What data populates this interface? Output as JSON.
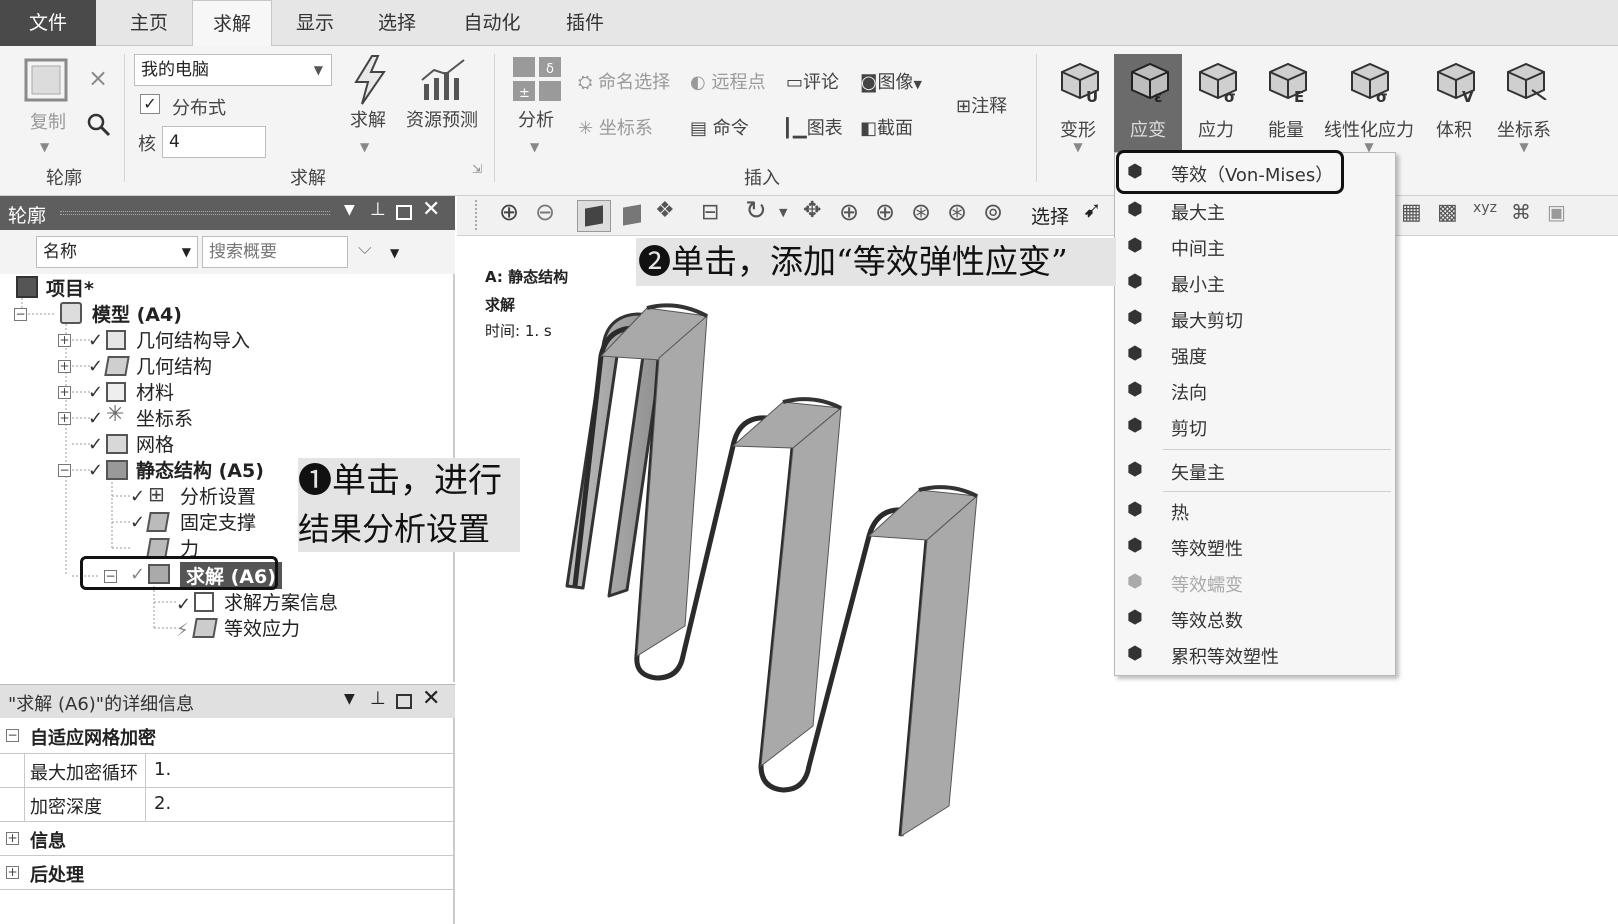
{
  "menu": {
    "tabs": [
      "文件",
      "主页",
      "求解",
      "显示",
      "选择",
      "自动化",
      "插件"
    ],
    "active_tab": "求解"
  },
  "ribbon": {
    "outline_group": {
      "copy_label": "复制",
      "group_label": "轮廓"
    },
    "solve_group": {
      "computer_select": "我的电脑",
      "distributed_label": "分布式",
      "cores_label": "核",
      "cores_value": "4",
      "solve_label": "求解",
      "resource_label": "资源预测",
      "group_label": "求解"
    },
    "insert_group": {
      "analysis_label": "分析",
      "named_selection": "命名选择",
      "remote_point": "远程点",
      "comment": "评论",
      "image": "图像",
      "annotation": "注释",
      "coord_system": "坐标系",
      "command": "命令",
      "chart": "图表",
      "section": "截面",
      "group_label": "插入"
    },
    "results": [
      {
        "label": "变形",
        "sub": "U"
      },
      {
        "label": "应变",
        "sub": "ε"
      },
      {
        "label": "应力",
        "sub": "σ"
      },
      {
        "label": "能量",
        "sub": "E"
      },
      {
        "label": "线性化应力",
        "sub": "σ"
      },
      {
        "label": "体积",
        "sub": "V"
      },
      {
        "label": "坐标系",
        "sub": ""
      }
    ]
  },
  "outline": {
    "title": "轮廓",
    "name_select": "名称",
    "search_placeholder": "搜索概要",
    "tree": {
      "project": "项目*",
      "model": "模型 (A4)",
      "geom_import": "几何结构导入",
      "geometry": "几何结构",
      "materials": "材料",
      "coord": "坐标系",
      "mesh": "网格",
      "static": "静态结构 (A5)",
      "analysis_settings": "分析设置",
      "fixed_support": "固定支撑",
      "force": "力",
      "solution": "求解 (A6)",
      "solution_info": "求解方案信息",
      "equiv_stress": "等效应力"
    }
  },
  "details": {
    "title": "\"求解 (A6)\"的详细信息",
    "section_adaptive": "自适应网格加密",
    "max_refine_label": "最大加密循环",
    "max_refine_value": "1.",
    "refine_depth_label": "加密深度",
    "refine_depth_value": "2.",
    "section_info": "信息",
    "section_post": "后处理"
  },
  "graphics": {
    "select_label": "选择",
    "annot_line1": "A: 静态结构",
    "annot_line2": "求解",
    "annot_line3": "时间: 1. s"
  },
  "dropdown": {
    "items": [
      "等效（Von-Mises）",
      "最大主",
      "中间主",
      "最小主",
      "最大剪切",
      "强度",
      "法向",
      "剪切",
      "矢量主",
      "热",
      "等效塑性",
      "等效蠕变",
      "等效总数",
      "累积等效塑性"
    ]
  },
  "callouts": {
    "step1_num": "❶",
    "step1_line1": "单击，进行",
    "step1_line2": "结果分析设置",
    "step2_num": "❷",
    "step2_text": "单击，添加“等效弹性应变”"
  }
}
